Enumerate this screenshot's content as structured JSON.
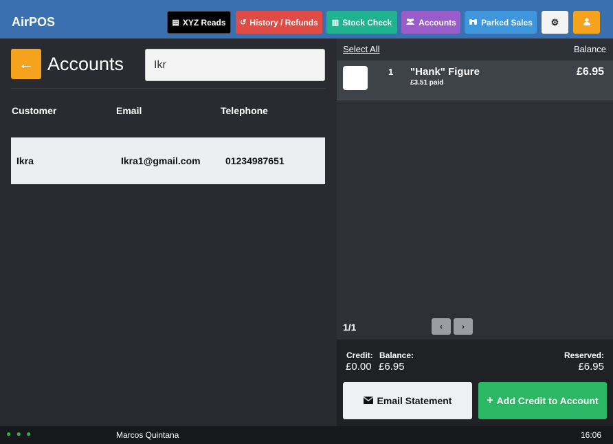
{
  "app": {
    "title": "AirPOS"
  },
  "toolbar": {
    "xyz_reads": "XYZ Reads",
    "history_refunds": "History / Refunds",
    "stock_check": "Stock Check",
    "accounts": "Accounts",
    "parked_sales": "Parked Sales",
    "colors": {
      "xyz": "#000000",
      "history": "#e14b45",
      "stock": "#1fb38f",
      "accounts": "#9a5cc8",
      "parked": "#3e97dc",
      "user": "#f5a21c"
    }
  },
  "accounts_panel": {
    "title": "Accounts",
    "search": {
      "value": "Ikr",
      "placeholder": ""
    },
    "columns": [
      "Customer",
      "Email",
      "Telephone"
    ],
    "rows": [
      {
        "customer": "Ikra",
        "email": "Ikra1@gmail.com",
        "telephone": "01234987651"
      }
    ]
  },
  "sales_panel": {
    "select_all": "Select All",
    "balance_label": "Balance",
    "items": [
      {
        "qty": "1",
        "name": "\"Hank\" Figure",
        "paid": "£3.51 paid",
        "price": "£6.95"
      }
    ],
    "pager": "1/1",
    "summary": {
      "credit_label": "Credit:",
      "credit_value": "£0.00",
      "balance_label": "Balance:",
      "balance_value": "£6.95",
      "reserved_label": "Reserved:",
      "reserved_value": "£6.95"
    },
    "email_statement": "Email Statement",
    "add_credit": "Add Credit to Account"
  },
  "status": {
    "user": "Marcos Quintana",
    "time": "16:06"
  }
}
